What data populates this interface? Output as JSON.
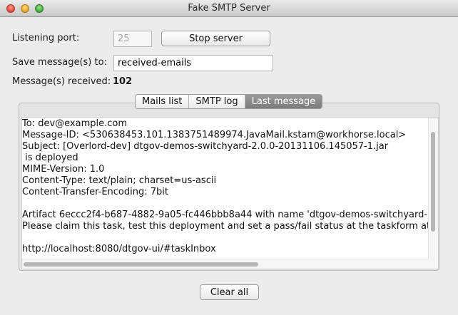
{
  "window": {
    "title": "Fake SMTP Server"
  },
  "config": {
    "port_label": "Listening port:",
    "port_value": "25",
    "stop_button": "Stop server",
    "save_label": "Save message(s) to:",
    "save_value": "received-emails",
    "received_label": "Message(s) received:",
    "received_count": "102"
  },
  "tabs": [
    {
      "label": "Mails list"
    },
    {
      "label": "SMTP log"
    },
    {
      "label": "Last message"
    }
  ],
  "message": {
    "lines": [
      "To: dev@example.com",
      "Message-ID: <530638453.101.1383751489974.JavaMail.kstam@workhorse.local>",
      "Subject: [Overlord-dev] dtgov-demos-switchyard-2.0.0-20131106.145057-1.jar",
      " is deployed",
      "MIME-Version: 1.0",
      "Content-Type: text/plain; charset=us-ascii",
      "Content-Transfer-Encoding: 7bit",
      "",
      "Artifact 6eccc2f4-b687-4882-9a05-fc446bbb8a44 with name 'dtgov-demos-switchyard-",
      "Please claim this task, test this deployment and set a pass/fail status at the taskform at",
      "",
      "http://localhost:8080/dtgov-ui/#taskInbox"
    ]
  },
  "footer": {
    "clear_button": "Clear all"
  }
}
